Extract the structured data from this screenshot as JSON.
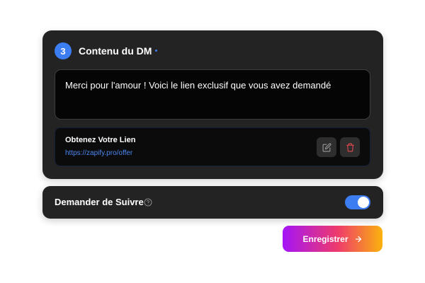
{
  "dm_card": {
    "step_number": "3",
    "title": "Contenu du DM",
    "message": "Merci pour l'amour ! Voici le lien exclusif que vous avez demandé",
    "link": {
      "title": "Obtenez Votre Lien",
      "url": "https://zapify.pro/offer",
      "edit_icon": "edit-icon",
      "delete_icon": "trash-icon"
    }
  },
  "follow_card": {
    "label": "Demander de Suivre",
    "help_icon": "help-circle-icon",
    "toggle_on": true
  },
  "save_button": {
    "label": "Enregistrer",
    "icon": "arrow-right-icon"
  },
  "colors": {
    "accent_blue": "#3c7df2",
    "card_bg": "#232323",
    "delete_red": "#e5484d",
    "gradient": [
      "#a415f7",
      "#ee3a6c",
      "#fbb20d"
    ]
  }
}
